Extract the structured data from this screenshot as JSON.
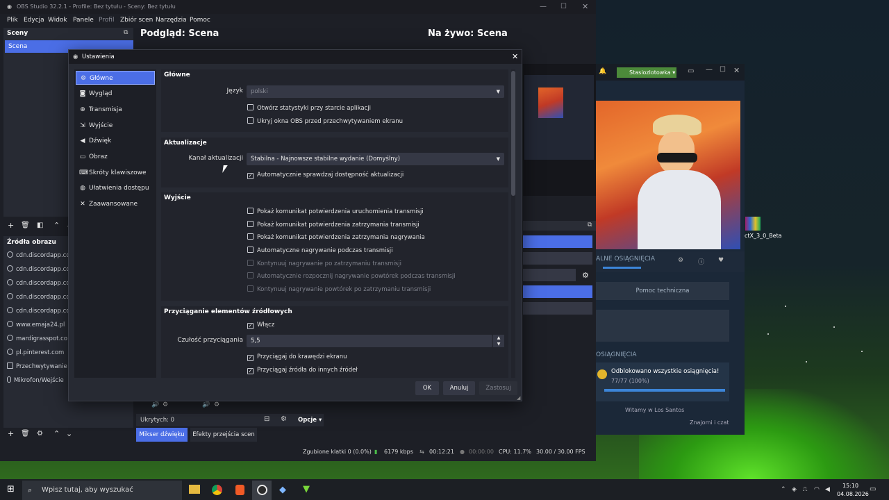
{
  "obs": {
    "window_title": "OBS Studio 32.2.1 - Profile: Bez tytułu - Sceny: Bez tytułu",
    "menu": [
      "Plik",
      "Edycja",
      "Widok",
      "Panele",
      "Profil",
      "Zbiór scen",
      "Narzędzia",
      "Pomoc"
    ],
    "scenes_header": "Sceny",
    "scene_item": "Scena",
    "preview_title": "Podgląd: Scena",
    "live_title": "Na żywo: Scena",
    "sources_header": "Źródła obrazu",
    "sources": [
      {
        "label": "cdn.discordapp.cc",
        "icon": "globe-icon"
      },
      {
        "label": "cdn.discordapp.cc",
        "icon": "globe-icon"
      },
      {
        "label": "cdn.discordapp.cc",
        "icon": "globe-icon"
      },
      {
        "label": "cdn.discordapp.cc",
        "icon": "globe-icon"
      },
      {
        "label": "cdn.discordapp.cc",
        "icon": "globe-icon"
      },
      {
        "label": "www.emaja24.pl",
        "icon": "globe-icon"
      },
      {
        "label": "mardigrasspot.co",
        "icon": "globe-icon"
      },
      {
        "label": "pl.pinterest.com",
        "icon": "globe-icon"
      },
      {
        "label": "Przechwytywanie",
        "icon": "monitor-icon"
      },
      {
        "label": "Mikrofon/Wejście",
        "icon": "microphone-icon"
      }
    ],
    "hidden_label": "Ukrytych: 0",
    "options_label": "Opcje",
    "mixer_tab": "Mikser dźwięku",
    "transitions_tab": "Efekty przejścia scen",
    "status": {
      "dropped_frames": "Zgubione klatki 0 (0.0%)",
      "bitrate": "6179 kbps",
      "stream_time": "00:12:21",
      "rec_time": "00:00:00",
      "cpu": "CPU: 11.7%",
      "fps": "30.00 / 30.00 FPS"
    }
  },
  "dialog": {
    "title": "Ustawienia",
    "nav": [
      {
        "label": "Główne",
        "icon": "gear-icon",
        "selected": true
      },
      {
        "label": "Wygląd",
        "icon": "palette-icon",
        "selected": false
      },
      {
        "label": "Transmisja",
        "icon": "antenna-icon",
        "selected": false
      },
      {
        "label": "Wyjście",
        "icon": "output-icon",
        "selected": false
      },
      {
        "label": "Dźwięk",
        "icon": "speaker-icon",
        "selected": false
      },
      {
        "label": "Obraz",
        "icon": "monitor-icon",
        "selected": false
      },
      {
        "label": "Skróty klawiszowe",
        "icon": "keyboard-icon",
        "selected": false
      },
      {
        "label": "Ułatwienia dostępu",
        "icon": "accessibility-icon",
        "selected": false
      },
      {
        "label": "Zaawansowane",
        "icon": "tools-icon",
        "selected": false
      }
    ],
    "general": {
      "title": "Główne",
      "language_label": "Język",
      "language_value": "polski",
      "checkboxes": [
        {
          "label": "Otwórz statystyki przy starcie aplikacji",
          "checked": false
        },
        {
          "label": "Ukryj okna OBS przed przechwytywaniem ekranu",
          "checked": false
        }
      ]
    },
    "updates": {
      "title": "Aktualizacje",
      "channel_label": "Kanał aktualizacji",
      "channel_value": "Stabilna - Najnowsze stabilne wydanie (Domyślny)",
      "auto_check_label": "Automatycznie sprawdzaj dostępność aktualizacji",
      "auto_check": true
    },
    "output": {
      "title": "Wyjście",
      "checkboxes": [
        {
          "label": "Pokaż komunikat potwierdzenia uruchomienia transmisji",
          "checked": false,
          "disabled": false
        },
        {
          "label": "Pokaż komunikat potwierdzenia zatrzymania transmisji",
          "checked": false,
          "disabled": false
        },
        {
          "label": "Pokaż komunikat potwierdzenia zatrzymania nagrywania",
          "checked": false,
          "disabled": false
        },
        {
          "label": "Automatyczne nagrywanie podczas transmisji",
          "checked": false,
          "disabled": false
        },
        {
          "label": "Kontynuuj nagrywanie po zatrzymaniu transmisji",
          "checked": false,
          "disabled": true
        },
        {
          "label": "Automatycznie rozpocznij nagrywanie powtórek podczas transmisji",
          "checked": false,
          "disabled": true
        },
        {
          "label": "Kontynuuj nagrywanie powtórek po zatrzymaniu transmisji",
          "checked": false,
          "disabled": true
        }
      ]
    },
    "snapping": {
      "title": "Przyciąganie elementów źródłowych",
      "enable_label": "Włącz",
      "enabled": true,
      "sensitivity_label": "Czułość przyciągania",
      "sensitivity_value": "5,5",
      "checkboxes": [
        {
          "label": "Przyciągaj do krawędzi ekranu",
          "checked": true
        },
        {
          "label": "Przyciągaj źródła do innych źródeł",
          "checked": true
        }
      ]
    },
    "buttons": {
      "ok": "OK",
      "cancel": "Anuluj",
      "apply": "Zastosuj"
    }
  },
  "steam": {
    "user": "Stasiozlotowka",
    "achievements_label": "ALNE OSIĄGNIĘCIA",
    "achievements_partial": "OSIĄGNIĘCIA",
    "support_button": "Pomoc techniczna",
    "achievement_title": "Odblokowano wszystkie osiągnięcia!",
    "achievement_count": "77/77 (100%)",
    "achievement_progress": 1.0,
    "news_title": "Witamy w Los Santos",
    "friends_label": "Znajomi i czat"
  },
  "desktop": {
    "winrar_label": "ctX_3_0_Beta"
  },
  "taskbar": {
    "search_placeholder": "Wpisz tutaj, aby wyszukać",
    "time": "15:10",
    "date": "04.08.2026"
  }
}
